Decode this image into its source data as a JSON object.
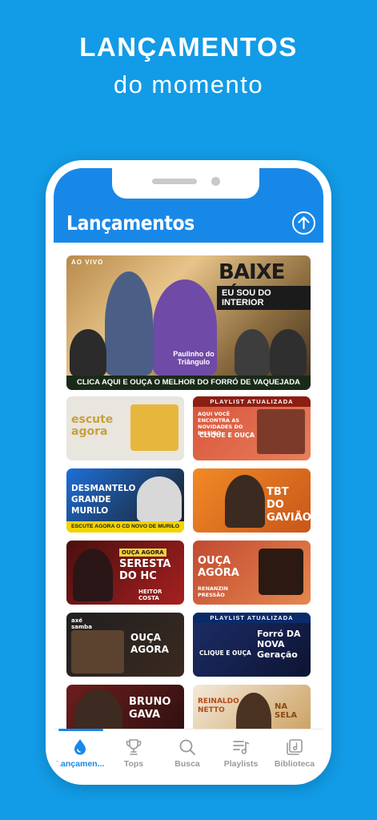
{
  "promo": {
    "title": "LANÇAMENTOS",
    "subtitle": "do momento"
  },
  "app": {
    "header_title": "Lançamentos"
  },
  "hero": {
    "live_label": "AO VIVO",
    "headline": "BAIXE JÁ",
    "subheadline": "EU SOU DO INTERIOR",
    "brand": "Paulinho do Triângulo",
    "bottom_text": "CLICA AQUI E OUÇA O MELHOR DO FORRÓ DE VAQUEJADA"
  },
  "cards": [
    {
      "title": "escute agora",
      "caption": ""
    },
    {
      "top": "PLAYLIST ATUALIZADA",
      "title": "CLIQUE E OUÇA",
      "caption": "AQUI VOCÊ ENCONTRA AS NOVIDADES DO PISEIRO"
    },
    {
      "title": "DESMANTELO GRANDE MURILO",
      "caption": "ESCUTE AGORA O CD NOVO DE MURILO BREGÃO"
    },
    {
      "title": "TBT DO GAVIÃO",
      "caption": ""
    },
    {
      "top": "OUÇA AGORA",
      "title": "SERESTA DO HC",
      "caption": "HEITOR COSTA"
    },
    {
      "title": "OUÇA AGORA",
      "caption": "RENANZIN PRESSÃO"
    },
    {
      "title": "OUÇA AGORA",
      "caption": "axé samba"
    },
    {
      "top": "PLAYLIST ATUALIZADA",
      "title": "Forró DA NOVA Geração",
      "caption": "CLIQUE E OUÇA"
    },
    {
      "title": "BRUNO GAVA",
      "caption": ""
    },
    {
      "title": "NA SELA",
      "caption": "REINALDO NETTO"
    }
  ],
  "tabs": [
    {
      "label": "Lançamen...",
      "icon": "drop-icon",
      "active": true
    },
    {
      "label": "Tops",
      "icon": "trophy-icon",
      "active": false
    },
    {
      "label": "Busca",
      "icon": "search-icon",
      "active": false
    },
    {
      "label": "Playlists",
      "icon": "playlist-icon",
      "active": false
    },
    {
      "label": "Biblioteca",
      "icon": "library-icon",
      "active": false
    }
  ],
  "colors": {
    "background": "#129be6",
    "header": "#1888e8",
    "active_tab": "#1888e8",
    "inactive_tab": "#9a9a9a"
  }
}
